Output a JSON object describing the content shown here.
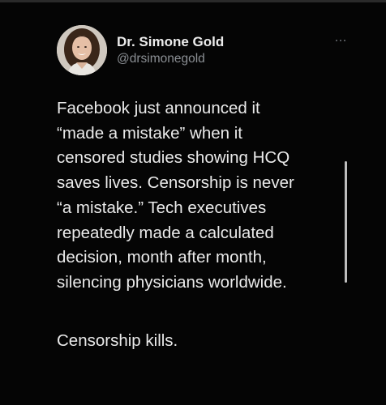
{
  "author": {
    "display_name": "Dr. Simone Gold",
    "handle": "@drsimonegold"
  },
  "tweet": {
    "lines": [
      "Facebook just announced it",
      "“made a mistake” when it",
      "censored studies showing HCQ",
      "saves lives. Censorship is never",
      "“a mistake.”  Tech executives",
      "repeatedly made a calculated",
      "decision, month after month,",
      "silencing physicians worldwide."
    ],
    "closing": "Censorship kills."
  },
  "icons": {
    "more": "more-horizontal-icon"
  },
  "colors": {
    "background": "#050505",
    "text": "#eaeaea",
    "secondary_text": "#8b8f94"
  }
}
